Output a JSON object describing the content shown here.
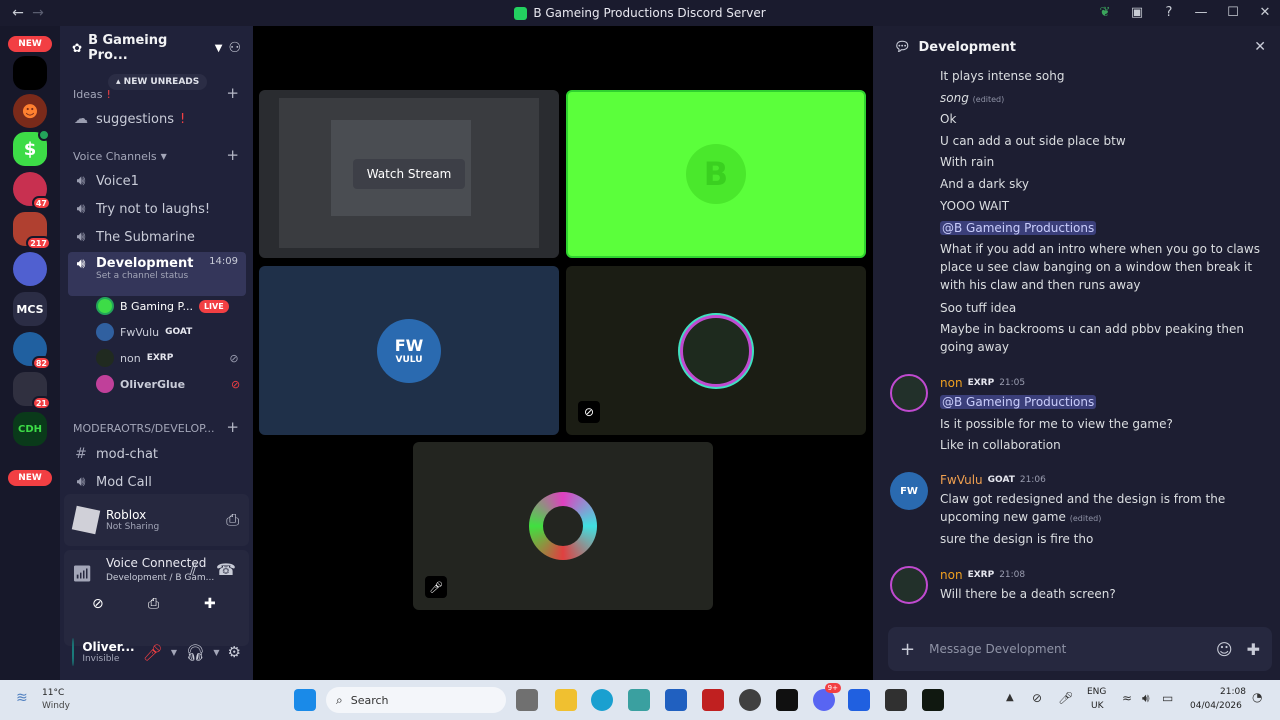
{
  "window": {
    "title": "B Gameing Productions Discord Server"
  },
  "rail": {
    "new_top": "NEW",
    "new_bottom": "NEW",
    "servers": [
      {
        "badge": ""
      },
      {
        "badge": ""
      },
      {
        "badge": "47"
      },
      {
        "badge": "217"
      },
      {
        "badge": ""
      },
      {
        "label": "MCS",
        "badge": ""
      },
      {
        "badge": "82"
      },
      {
        "badge": "21"
      },
      {
        "badge": ""
      }
    ]
  },
  "sidebar": {
    "server_name": "B Gameing Pro...",
    "new_unreads": "NEW UNREADS",
    "cat_ideas": "Ideas",
    "chan_suggestions": "suggestions",
    "cat_voice": "Voice Channels",
    "voice1": "Voice1",
    "try_not": "Try not to laughs!",
    "submarine": "The Submarine",
    "development": "Development",
    "dev_time": "14:09",
    "dev_status": "Set a channel status",
    "members": [
      {
        "name": "B Gaming P...",
        "tag": "LIVE"
      },
      {
        "name": "FwVulu",
        "tag": "GOAT"
      },
      {
        "name": "non",
        "tag": "EXRP"
      },
      {
        "name": "OliverGlue",
        "tag": ""
      }
    ],
    "cat_mod": "MODERAOTRS/DEVELOP...",
    "mod_chat": "mod-chat",
    "mod_call": "Mod Call",
    "stream_app": "Roblox",
    "stream_status": "Not Sharing",
    "voice_connected": "Voice Connected",
    "voice_location": "Development / B Gam...",
    "user_name": "Oliver...",
    "user_status": "Invisible"
  },
  "stage": {
    "watch_stream": "Watch Stream",
    "tile_green_letter": "B",
    "tile_fw_line1": "FW",
    "tile_fw_line2": "VULU"
  },
  "chat": {
    "channel": "Development",
    "messages_top": [
      {
        "text": "It plays intense sohg"
      },
      {
        "text": "song",
        "edited": "(edited)"
      },
      {
        "text": "Ok"
      },
      {
        "text": "U can add a out side place btw"
      },
      {
        "text": "With rain"
      },
      {
        "text": "And a dark sky"
      },
      {
        "text": "YOOO WAIT"
      },
      {
        "text": "@B Gameing Productions"
      },
      {
        "text": "What if you add an intro where when you go to claws place u see claw banging on a window then break it with his claw and then runs away"
      },
      {
        "text": "Soo tuff idea"
      },
      {
        "text": "Maybe in backrooms u can add pbbv peaking then going away"
      }
    ],
    "group_non1": {
      "author": "non",
      "tag": "EXRP",
      "time": "21:05",
      "lines": [
        "@B Gameing Productions",
        "Is it possible for me to view the game?",
        "Like in collaboration"
      ]
    },
    "group_fw": {
      "author": "FwVulu",
      "tag": "GOAT",
      "time": "21:06",
      "lines": [
        "Claw got redesigned and the design is from the upcoming new game",
        "sure the design is fire tho"
      ],
      "edited": "(edited)"
    },
    "group_non2": {
      "author": "non",
      "tag": "EXRP",
      "time": "21:08",
      "lines": [
        "Will there be a death screen?"
      ]
    },
    "composer_placeholder": "Message Development"
  },
  "taskbar": {
    "weather_temp": "11°C",
    "weather_desc": "Windy",
    "search": "Search",
    "lang1": "ENG",
    "lang2": "UK",
    "time": "21:08",
    "date": "04/04/2026",
    "discord_badge": "9+"
  },
  "colors": {
    "accent_green": "#5bff3b",
    "live_red": "#f23f43",
    "fw_orange": "#f0a050",
    "non_orange": "#f0a020"
  }
}
